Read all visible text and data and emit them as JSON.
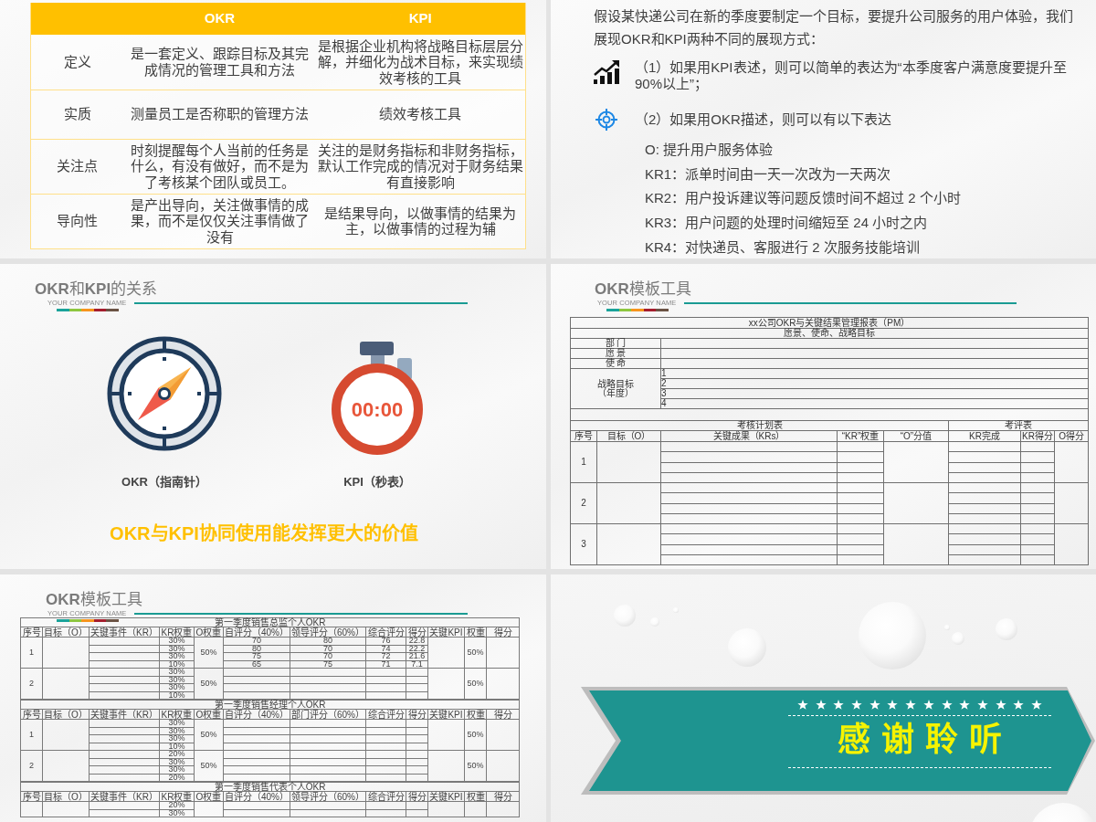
{
  "slides": [
    {
      "kind": "compare",
      "columns": [
        "OKR",
        "KPI"
      ],
      "rows": [
        {
          "label": "定义",
          "cells": [
            "是一套定义、跟踪目标及其完成情况的管理工具和方法",
            "是根据企业机构将战略目标层层分解，并细化为战术目标，来实现绩效考核的工具"
          ]
        },
        {
          "label": "实质",
          "cells": [
            "测量员工是否称职的管理方法",
            "绩效考核工具"
          ]
        },
        {
          "label": "关注点",
          "cells": [
            "时刻提醒每个人当前的任务是什么，有没有做好，而不是为了考核某个团队或员工。",
            "关注的是财务指标和非财务指标，默认工作完成的情况对于财务结果有直接影响"
          ]
        },
        {
          "label": "导向性",
          "cells": [
            "是产出导向，关注做事情的成果，而不是仅仅关注事情做了没有",
            "是结果导向，以做事情的结果为主，以做事情的过程为辅"
          ]
        }
      ]
    },
    {
      "kind": "example",
      "intro": "假设某快递公司在新的季度要制定一个目标，要提升公司服务的用户体验，我们展现OKR和KPI两种不同的展现方式：",
      "points": [
        {
          "kind": "kpi",
          "text": "（1）如果用KPI表述，则可以简单的表达为“本季度客户满意度要提升至90%以上”；"
        },
        {
          "kind": "okr",
          "text": "（2）如果用OKR描述，则可以有以下表达"
        }
      ],
      "okr_lines": [
        "O: 提升用户服务体验",
        "KR1：派单时间由一天一次改为一天两次",
        "KR2：用户投诉建议等问题反馈时间不超过 2 个小时",
        "KR3：用户问题的处理时间缩短至 24 小时之内",
        "KR4：对快递员、客服进行 2 次服务技能培训"
      ]
    },
    {
      "kind": "relation",
      "title": "**OKR**和**KPI**的关系",
      "company": "YOUR COMPANY NAME",
      "figures": [
        {
          "kind": "compass",
          "label": "OKR（指南针）"
        },
        {
          "kind": "stopwatch",
          "label": "KPI（秒表）",
          "time": "00:00"
        }
      ],
      "conclusion": "OKR与KPI协同使用能发挥更大的价值"
    },
    {
      "kind": "form",
      "title": "**OKR**模板工具",
      "company": "YOUR COMPANY NAME",
      "form": {
        "heading": "xx公司OKR与关键结果管理报表（PM）",
        "subheading": "愿景、使命、战略目标",
        "fields": [
          "部 门",
          "愿 景",
          "使 命"
        ],
        "goals_label": "战略目标（年度）",
        "goal_numbers": [
          "1",
          "2",
          "3",
          "4"
        ],
        "plan_heading": "考核计划表",
        "review_heading": "考评表",
        "columns": [
          "序号",
          "目标（O）",
          "关键成果（KRs）",
          "“KR”权重",
          "“O”分值",
          "KR完成",
          "KR得分",
          "O得分"
        ],
        "row_numbers": [
          "1",
          "2",
          "3"
        ]
      }
    },
    {
      "kind": "sheet",
      "title": "**OKR**模板工具",
      "company": "YOUR COMPANY NAME",
      "sections": [
        {
          "title": "第一季度销售总监个人OKR",
          "columns": [
            "序号",
            "目标（O）",
            "关键事件（KR）",
            "KR权重",
            "O权重",
            "自评分（40%）",
            "领导评分（60%）",
            "综合评分",
            "得分",
            "关键KPI",
            "权重",
            "得分"
          ],
          "rows": [
            {
              "number": "1",
              "kr_weights": [
                "30%",
                "30%",
                "30%",
                "10%"
              ],
              "o_weight": "50%",
              "self_scores": [
                "70",
                "80",
                "75",
                "65"
              ],
              "leader_scores": [
                "80",
                "70",
                "70",
                "75"
              ],
              "combined_scores": [
                "76",
                "74",
                "72",
                "71"
              ],
              "kr_scores": [
                "22.8",
                "22.2",
                "21.6",
                "7.1"
              ],
              "kpi_weight": "50%"
            },
            {
              "number": "2",
              "kr_weights": [
                "30%",
                "30%",
                "30%",
                "10%"
              ],
              "o_weight": "50%",
              "kpi_weight": "50%"
            }
          ]
        },
        {
          "title": "第一季度销售经理个人OKR",
          "columns": [
            "序号",
            "目标（O）",
            "关键事件（KR）",
            "KR权重",
            "O权重",
            "自评分（40%）",
            "部门评分（60%）",
            "综合评分",
            "得分",
            "关键KPI",
            "权重",
            "得分"
          ],
          "rows": [
            {
              "number": "1",
              "kr_weights": [
                "30%",
                "30%",
                "30%",
                "10%"
              ],
              "o_weight": "50%",
              "kpi_weight": "50%"
            },
            {
              "number": "2",
              "kr_weights": [
                "20%",
                "30%",
                "30%",
                "20%"
              ],
              "o_weight": "50%",
              "kpi_weight": "50%"
            }
          ]
        },
        {
          "title": "第一季度销售代表个人OKR",
          "columns": [
            "序号",
            "目标（O）",
            "关键事件（KR）",
            "KR权重",
            "O权重",
            "自评分（40%）",
            "领导评分（60%）",
            "综合评分",
            "得分",
            "关键KPI",
            "权重",
            "得分"
          ],
          "rows": [
            {
              "kr_weights": [
                "20%",
                "30%"
              ]
            }
          ]
        }
      ]
    },
    {
      "kind": "closing",
      "heading": "感谢聆听"
    }
  ]
}
